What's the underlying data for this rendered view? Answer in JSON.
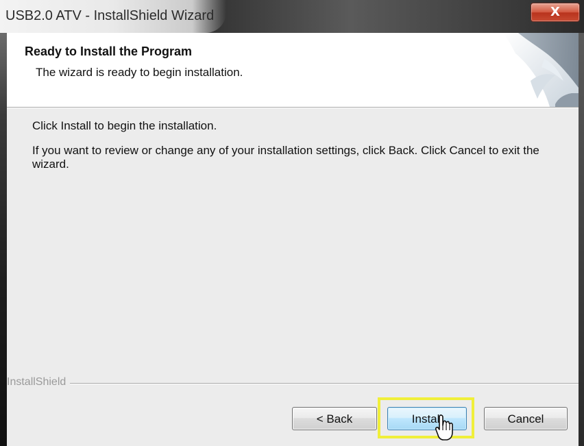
{
  "window": {
    "title": "USB2.0 ATV - InstallShield Wizard",
    "close_glyph": "X"
  },
  "header": {
    "title": "Ready to Install the Program",
    "subtitle": "The wizard is ready to begin installation."
  },
  "body": {
    "line1": "Click Install to begin the installation.",
    "line2": "If you want to review or change any of your installation settings, click Back. Click Cancel to exit the wizard."
  },
  "footer": {
    "brand": "InstallShield",
    "back_label": "< Back",
    "install_label": "Install",
    "cancel_label": "Cancel"
  },
  "colors": {
    "highlight": "#f0ef3a",
    "close_button": "#c74a32",
    "default_button": "#bee6fd"
  },
  "icons": {
    "close": "close-icon",
    "header_graphic": "installshield-banner-graphic",
    "pointer": "hand-pointer-icon"
  }
}
